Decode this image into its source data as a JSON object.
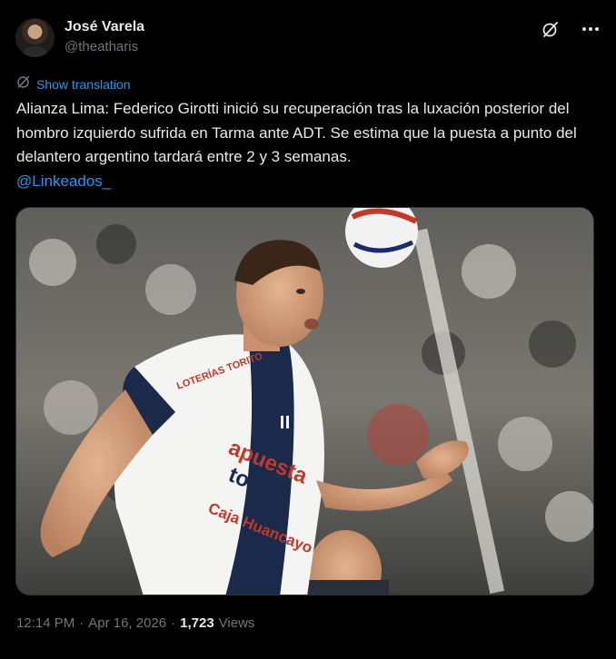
{
  "author": {
    "display_name": "José Varela",
    "handle": "@theatharis"
  },
  "header_icons": {
    "grok": "grok-slash-icon",
    "more": "more-dots-icon"
  },
  "translate": {
    "icon": "globe-translate-icon",
    "label": "Show translation"
  },
  "tweet": {
    "text": "Alianza Lima: Federico Girotti inició su recuperación tras la luxación posterior del hombro izquierdo sufrida en Tarma ante ADT. Se estima que la puesta a punto del delantero argentino tardará entre 2 y 3 semanas.",
    "mention": "@Linkeados_"
  },
  "photo": {
    "jersey_sponsor_1": "apuesta",
    "jersey_sponsor_2": "total",
    "jersey_sponsor_3": "Caja Huancayo",
    "sleeve_sponsor": "LOTERÍAS TORITO"
  },
  "meta": {
    "time": "12:14 PM",
    "separator": "·",
    "date": "Apr 16, 2026",
    "views_count": "1,723",
    "views_label": "Views"
  },
  "colors": {
    "background": "#000000",
    "text": "#e7e9ea",
    "secondary": "#71767b",
    "link": "#1d9bf0",
    "jersey_navy": "#1b2a4a"
  }
}
